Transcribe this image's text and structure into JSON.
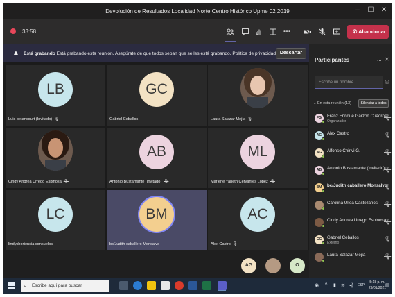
{
  "window": {
    "title": "Devolución de Resultados Localidad Norte Centro Histórico Upme 02 2019",
    "minimize": "–",
    "maximize": "☐",
    "close": "✕"
  },
  "toolbar": {
    "timer": "33:58",
    "leave_label": "Abandonar",
    "more": "•••"
  },
  "banner": {
    "bold": "Está grabando",
    "text": "  Está grabando esta reunión. Asegúrate de que todos sepan que se les está grabando.",
    "link": "Política de privacidad",
    "dismiss": "Descartar"
  },
  "tiles": [
    {
      "initials": "LB",
      "name": "Luis betancourt (Invitado)",
      "color": "#c7e6ec",
      "muted": true
    },
    {
      "initials": "GC",
      "name": "Gabriel Ceballos",
      "color": "#f3e2c4",
      "muted": false
    },
    {
      "initials": "",
      "name": "Laura Salazar Mejía",
      "color": "",
      "muted": true,
      "photo": true
    },
    {
      "initials": "",
      "name": "Cindy Andrea Urrego Espinosa",
      "color": "",
      "muted": true,
      "photo": true
    },
    {
      "initials": "AB",
      "name": "Antonio Bustamante (Invitado)",
      "color": "#ecd3df",
      "muted": true
    },
    {
      "initials": "ML",
      "name": "Marlene Yaneth Cervantes López",
      "color": "#ecd3df",
      "muted": true
    },
    {
      "initials": "LC",
      "name": "lindyshortencia consuelos",
      "color": "#c7e6ec",
      "muted": false
    },
    {
      "initials": "BM",
      "name": "bc/Judith caballero Monsalvo",
      "color": "#f3cf8f",
      "muted": false,
      "speaking": true
    },
    {
      "initials": "AC",
      "name": "Alex Castro",
      "color": "#c7e6ec",
      "muted": true
    }
  ],
  "overflow": [
    {
      "initials": "AG",
      "color": "#f3e2c4"
    },
    {
      "initials": "",
      "color": "#b59a83",
      "photo": true
    },
    {
      "initials": "O",
      "color": "#d6e8c8"
    }
  ],
  "panel": {
    "title": "Participantes",
    "more": "...",
    "search_placeholder": "Escribe un nombre",
    "section": "En esta reunión (13)",
    "mute_all": "Silenciar a todos",
    "people": [
      {
        "initials": "FG",
        "name": "Franz Enrique Garzon Cuadros",
        "sub": "Organizador",
        "color": "#ecd3df",
        "muted": true
      },
      {
        "initials": "AC",
        "name": "Alex Castro",
        "sub": "",
        "color": "#c7e6ec",
        "muted": true
      },
      {
        "initials": "AG",
        "name": "Alfonso Chirivi G.",
        "sub": "",
        "color": "#f3e2c4",
        "muted": true
      },
      {
        "initials": "AB",
        "name": "Antonio Bustamante (Invitado)",
        "sub": "",
        "color": "#ecd3df",
        "muted": true
      },
      {
        "initials": "BM",
        "name": "bc/Judith caballero Monsalvo",
        "sub": "",
        "color": "#f3cf8f",
        "muted": false,
        "bold": true
      },
      {
        "initials": "",
        "name": "Carolina Ulloa Castellanos",
        "sub": "",
        "color": "#a98a70",
        "muted": true,
        "photo": true
      },
      {
        "initials": "",
        "name": "Cindy Andrea Urrego Espinosa",
        "sub": "",
        "color": "#7c5a44",
        "muted": true,
        "photo": true
      },
      {
        "initials": "GC",
        "name": "Gabriel Ceballos",
        "sub": "Externo",
        "color": "#f3e2c4",
        "muted": false
      },
      {
        "initials": "",
        "name": "Laura Salazar Mejía",
        "sub": "",
        "color": "#8a6a58",
        "muted": true,
        "photo": true
      }
    ]
  },
  "taskbar": {
    "search": "Escribe aquí para buscar",
    "time": "5:18 p. m.",
    "date": "29/01/2021",
    "lang": "ESP"
  },
  "colors": {
    "accent": "#6264a7",
    "leave": "#c4314b",
    "banner": "#2b2b40"
  }
}
